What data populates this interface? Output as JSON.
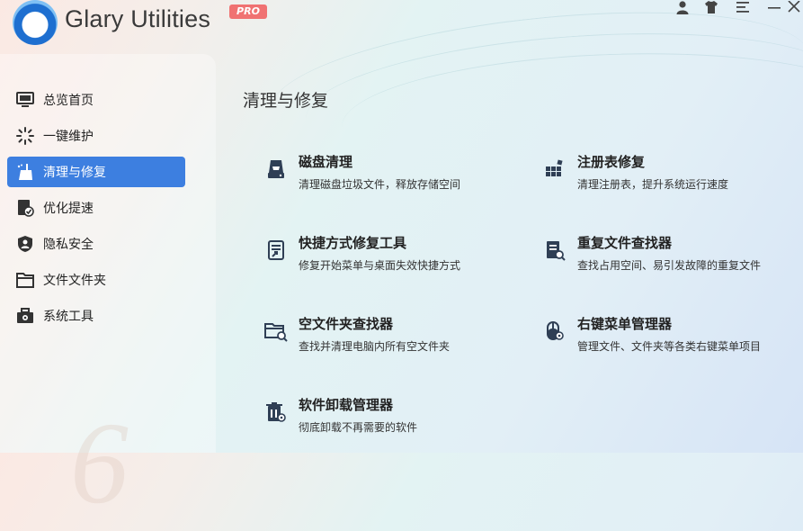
{
  "app": {
    "title": "Glary Utilities",
    "badge": "PRO",
    "accent_color": "#3d7fe0"
  },
  "window_controls": [
    {
      "name": "account-icon"
    },
    {
      "name": "skin-icon"
    },
    {
      "name": "menu-icon"
    },
    {
      "name": "minimize-icon"
    },
    {
      "name": "close-icon"
    }
  ],
  "sidebar": {
    "items": [
      {
        "label": "总览首页",
        "icon": "monitor-icon"
      },
      {
        "label": "一键维护",
        "icon": "sparkle-icon"
      },
      {
        "label": "清理与修复",
        "icon": "broom-icon",
        "active": true
      },
      {
        "label": "优化提速",
        "icon": "checklist-icon"
      },
      {
        "label": "隐私安全",
        "icon": "shield-icon"
      },
      {
        "label": "文件文件夹",
        "icon": "folder-icon"
      },
      {
        "label": "系统工具",
        "icon": "toolbox-icon"
      }
    ],
    "watermark": "6"
  },
  "main": {
    "section_title": "清理与修复",
    "tools": [
      {
        "name": "磁盘清理",
        "desc": "清理磁盘垃圾文件，释放存储空间",
        "icon": "disk-icon"
      },
      {
        "name": "注册表修复",
        "desc": "清理注册表，提升系统运行速度",
        "icon": "registry-icon"
      },
      {
        "name": "快捷方式修复工具",
        "desc": "修复开始菜单与桌面失效快捷方式",
        "icon": "shortcut-icon"
      },
      {
        "name": "重复文件查找器",
        "desc": "查找占用空间、易引发故障的重复文件",
        "icon": "duplicate-file-icon"
      },
      {
        "name": "空文件夹查找器",
        "desc": "查找并清理电脑内所有空文件夹",
        "icon": "empty-folder-icon"
      },
      {
        "name": "右键菜单管理器",
        "desc": "管理文件、文件夹等各类右键菜单项目",
        "icon": "mouse-icon"
      },
      {
        "name": "软件卸载管理器",
        "desc": "彻底卸载不再需要的软件",
        "icon": "uninstall-icon"
      }
    ]
  }
}
